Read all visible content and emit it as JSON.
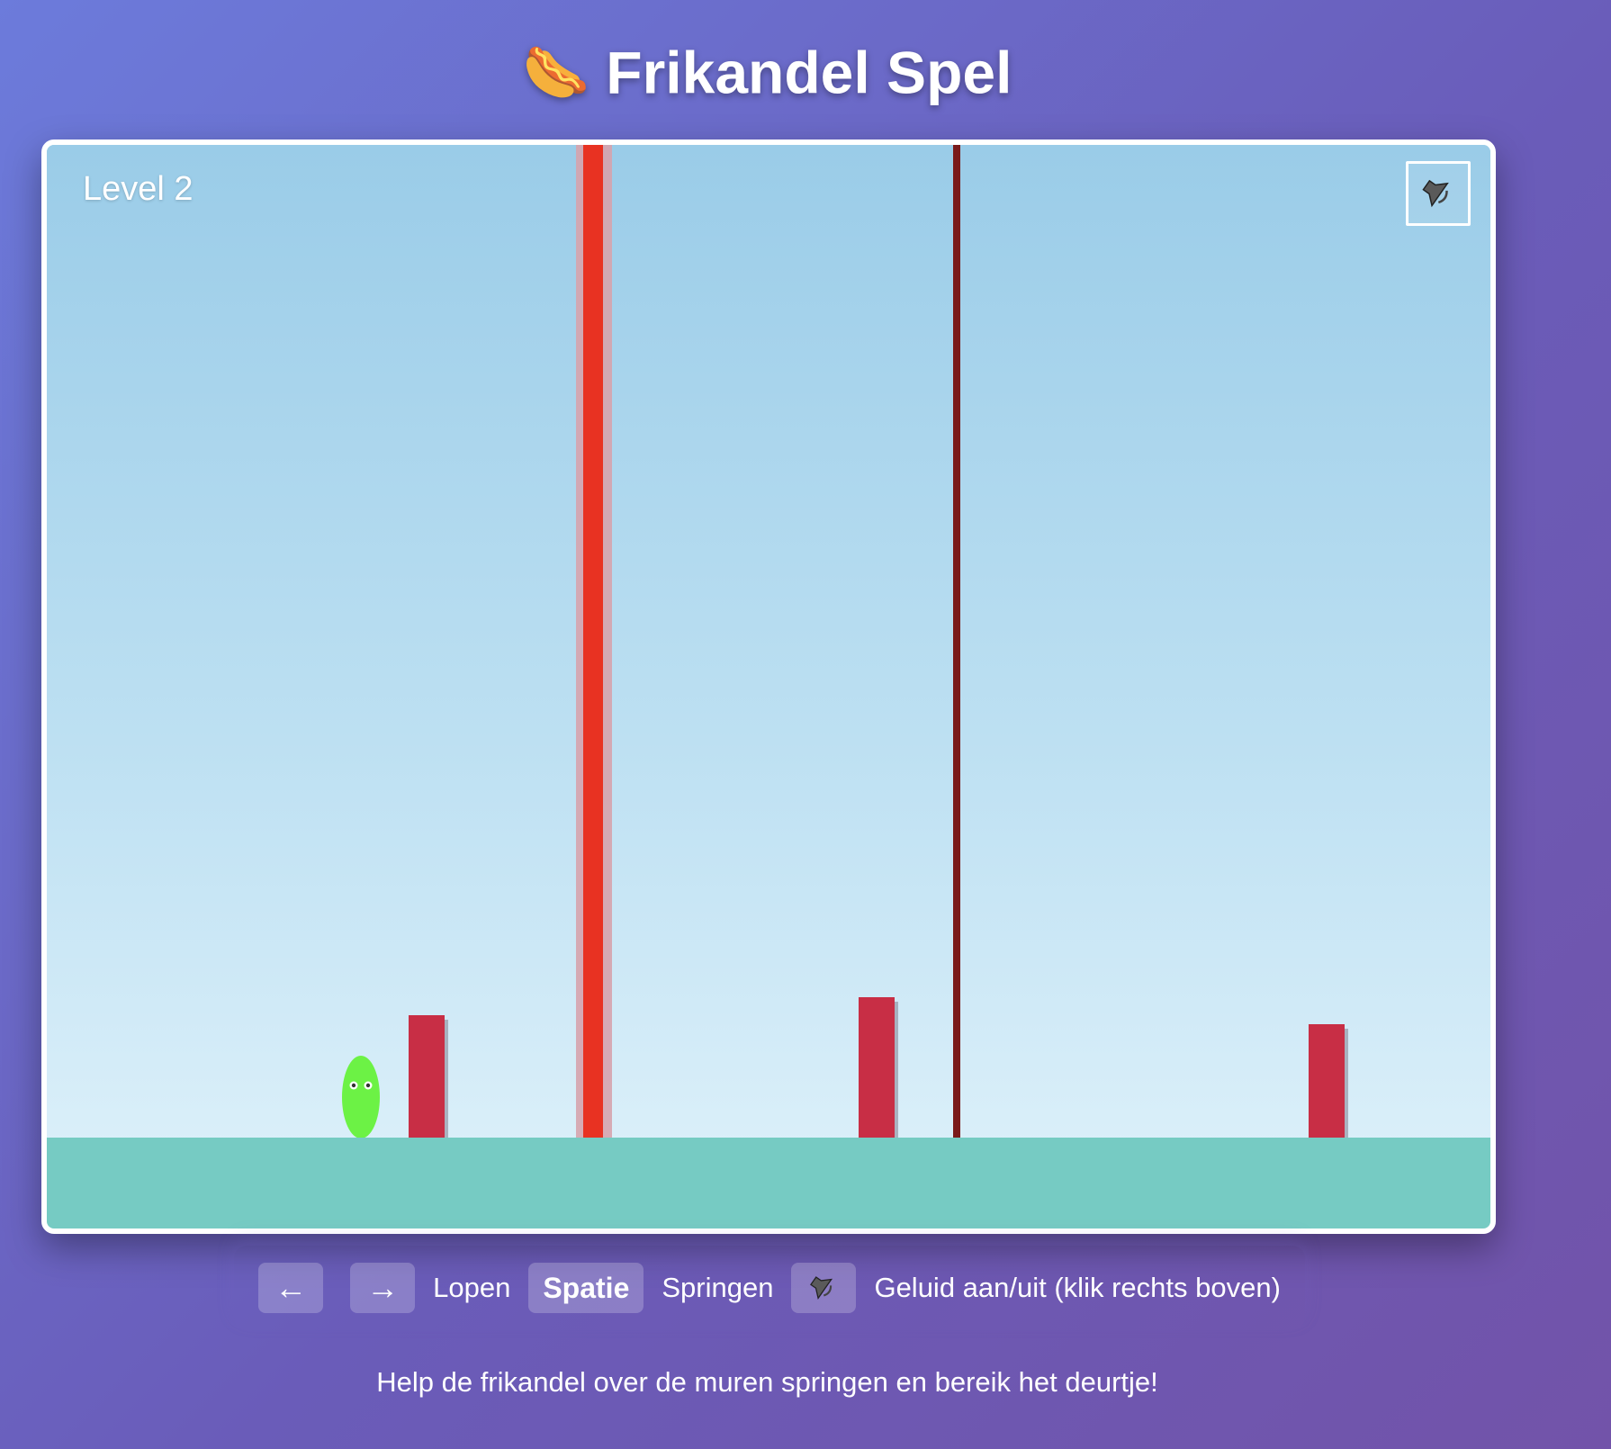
{
  "header": {
    "emoji": "🌭",
    "title": "Frikandel Spel"
  },
  "game": {
    "level_label": "Level 2",
    "sound_icon": "speaker-muted-icon",
    "colors": {
      "sky_top": "#9acce8",
      "sky_bottom": "#dff1fb",
      "ground": "#76cbc3",
      "wall": "#c82e45",
      "laser_core": "#e83222",
      "laser_glow": "#e89aa4",
      "thin_pole": "#7a1a1a",
      "player": "#6cf245"
    }
  },
  "controls": {
    "left_key": "←",
    "right_key": "→",
    "walk_label": "Lopen",
    "jump_key": "Spatie",
    "jump_label": "Springen",
    "sound_key_icon": "speaker-icon",
    "sound_label": "Geluid aan/uit (klik rechts boven)"
  },
  "help_text": "Help de frikandel over de muren springen en bereik het deurtje!"
}
